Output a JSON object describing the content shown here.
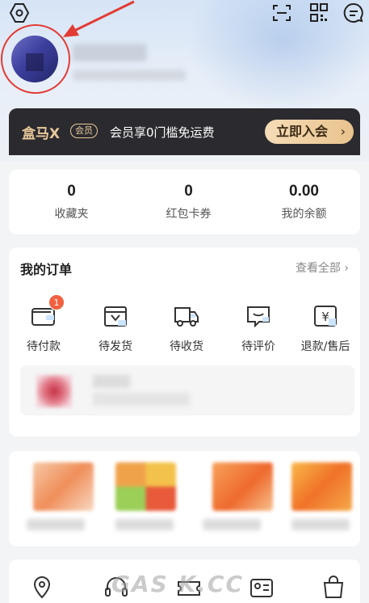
{
  "header": {
    "icons": [
      "settings-icon",
      "scan-icon",
      "qrcode-icon",
      "message-icon"
    ]
  },
  "member": {
    "logo": "盒马X",
    "badge": "会员",
    "promo": "会员享0门槛免运费",
    "join_label": "立即入会",
    "join_chevron": "›"
  },
  "stats": [
    {
      "value": "0",
      "label": "收藏夹"
    },
    {
      "value": "0",
      "label": "红包卡券"
    },
    {
      "value": "0.00",
      "label": "我的余额"
    }
  ],
  "orders": {
    "title": "我的订单",
    "view_all": "查看全部 ›",
    "items": [
      {
        "label": "待付款",
        "badge": "1",
        "icon": "wallet-icon"
      },
      {
        "label": "待发货",
        "icon": "package-icon"
      },
      {
        "label": "待收货",
        "icon": "truck-icon"
      },
      {
        "label": "待评价",
        "icon": "review-icon"
      },
      {
        "label": "退款/售后",
        "icon": "refund-icon"
      }
    ]
  },
  "tools": [
    "location-icon",
    "customer-service-icon",
    "coupon-icon",
    "profile-card-icon",
    "shopping-bag-icon"
  ],
  "watermark": "GAS K.CC",
  "colors": {
    "accent_red": "#e33a34",
    "badge_orange": "#f2603f",
    "member_dark": "#2b2b2f",
    "member_gold": "#e9c99a"
  }
}
